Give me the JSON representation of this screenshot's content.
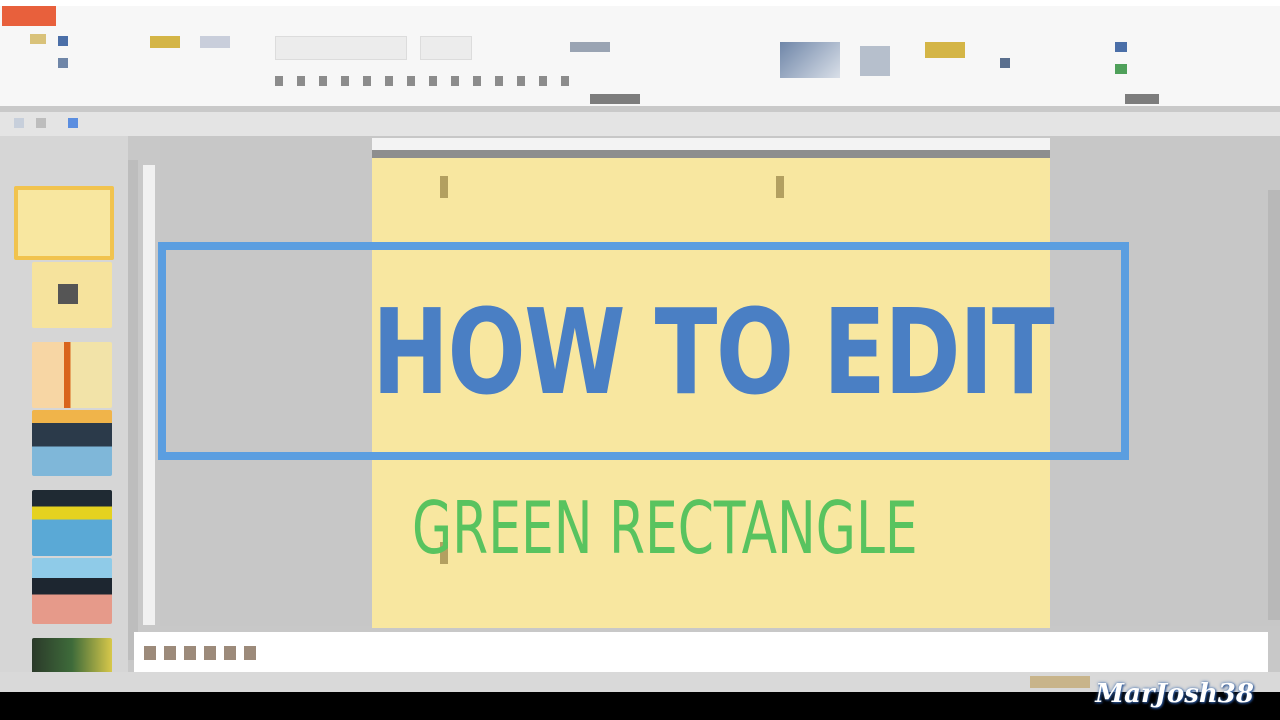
{
  "colors": {
    "file_tab": "#e8603c",
    "slide_background": "#f8e7a0",
    "title_text": "#4a7fc4",
    "highlight_box": "#5b9ee0",
    "subtitle_text": "#59c35f",
    "workspace": "#c8c8c8"
  },
  "slide": {
    "title": "HOW TO EDIT",
    "subtitle": "GREEN RECTANGLE"
  },
  "watermark": "MarJosh38"
}
